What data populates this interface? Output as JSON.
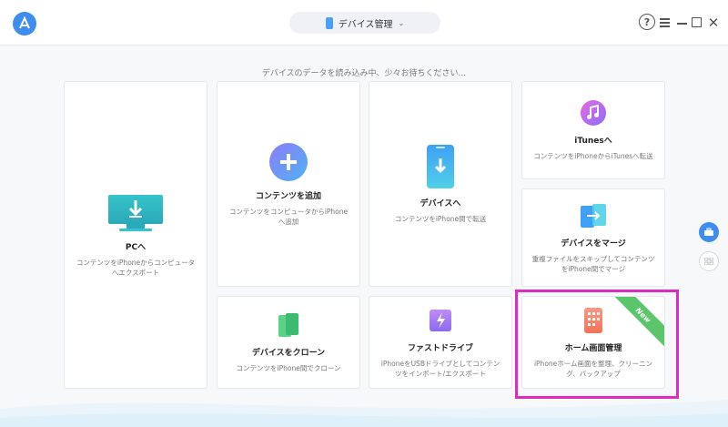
{
  "header": {
    "device_name": "デバイス管理",
    "help_label": "?",
    "close_label": "✕"
  },
  "status_text": "デバイスのデータを読み込み中、少々お待ちください...",
  "cards": {
    "pc": {
      "title": "PCへ",
      "desc": "コンテンツをiPhoneからコンピュータへエクスポート"
    },
    "add": {
      "title": "コンテンツを追加",
      "desc": "コンテンツをコンピュータからiPhoneへ追加"
    },
    "device": {
      "title": "デバイスへ",
      "desc": "コンテンツをiPhone間で転送"
    },
    "itunes": {
      "title": "iTunesへ",
      "desc": "コンテンツをiPhoneからiTunesへ転送"
    },
    "merge": {
      "title": "デバイスをマージ",
      "desc": "重複ファイルをスキップしてコンテンツをiPhone間でマージ"
    },
    "clone": {
      "title": "デバイスをクローン",
      "desc": "コンテンツをiPhone間でクローン"
    },
    "fastdrive": {
      "title": "ファストドライブ",
      "desc": "iPhoneをUSBドライブとしてコンテンツをインポート/エクスポート"
    },
    "home": {
      "title": "ホーム画面管理",
      "desc": "iPhoneホーム画面を整理、クリーニング、バックアップ",
      "badge": "New"
    }
  },
  "colors": {
    "accent": "#3d8ef0",
    "highlight": "#e02bc1",
    "badge": "#5cc46a"
  }
}
